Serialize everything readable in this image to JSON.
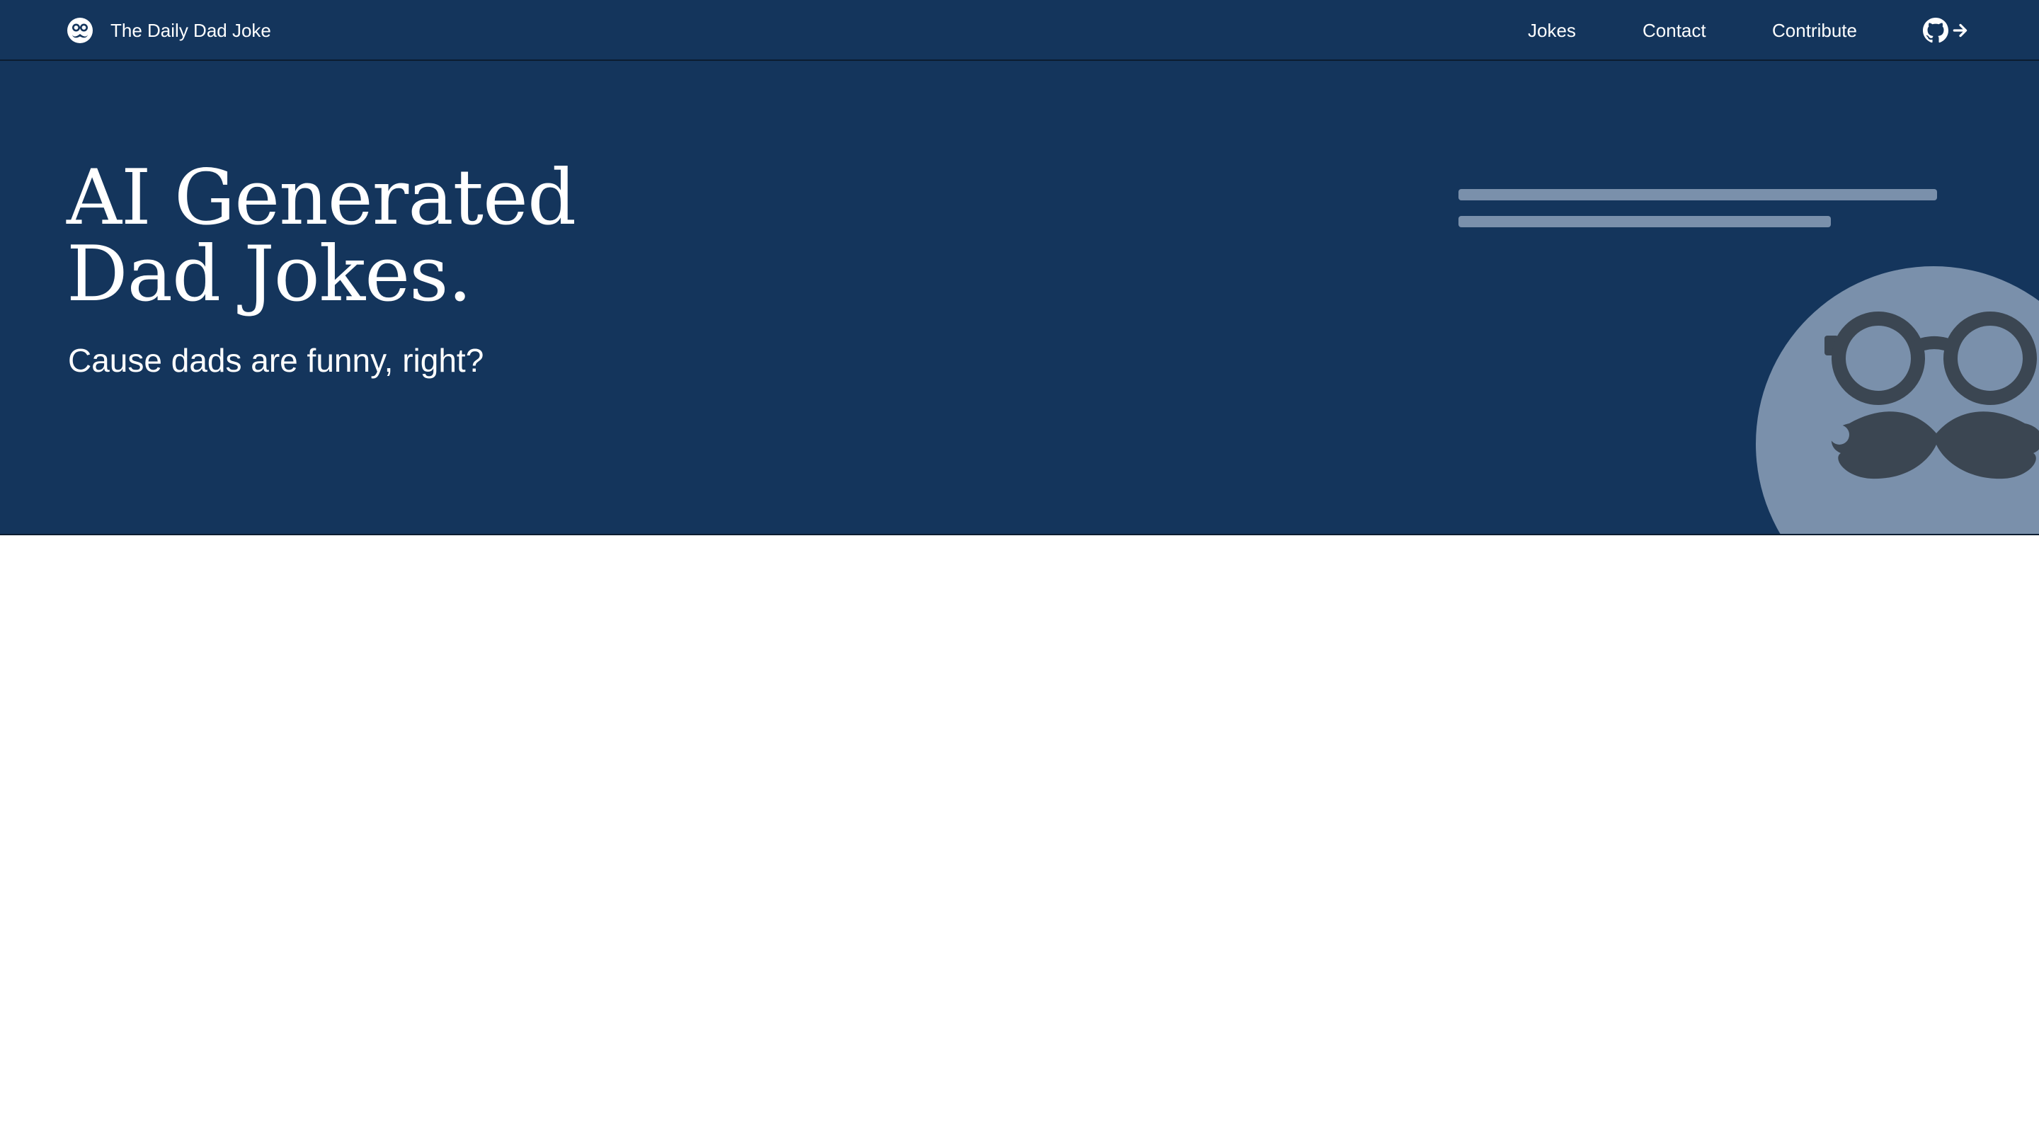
{
  "app": {
    "brand_name": "The Daily Dad Joke",
    "logo_icon": "dad-face-icon"
  },
  "nav": {
    "items": [
      {
        "label": "Jokes"
      },
      {
        "label": "Contact"
      },
      {
        "label": "Contribute"
      }
    ],
    "github_icon": "github-icon",
    "arrow_icon": "arrow-right-icon"
  },
  "hero": {
    "title_line1": "AI Generated",
    "title_line2": "Dad Jokes.",
    "subtitle": "Cause dads are funny, right?",
    "illustration": "dad-face-glasses-mustache-icon"
  },
  "colors": {
    "navy": "#14355c",
    "muted_blue": "#7a90ab",
    "dark_slate": "#3b4652",
    "white": "#ffffff"
  }
}
